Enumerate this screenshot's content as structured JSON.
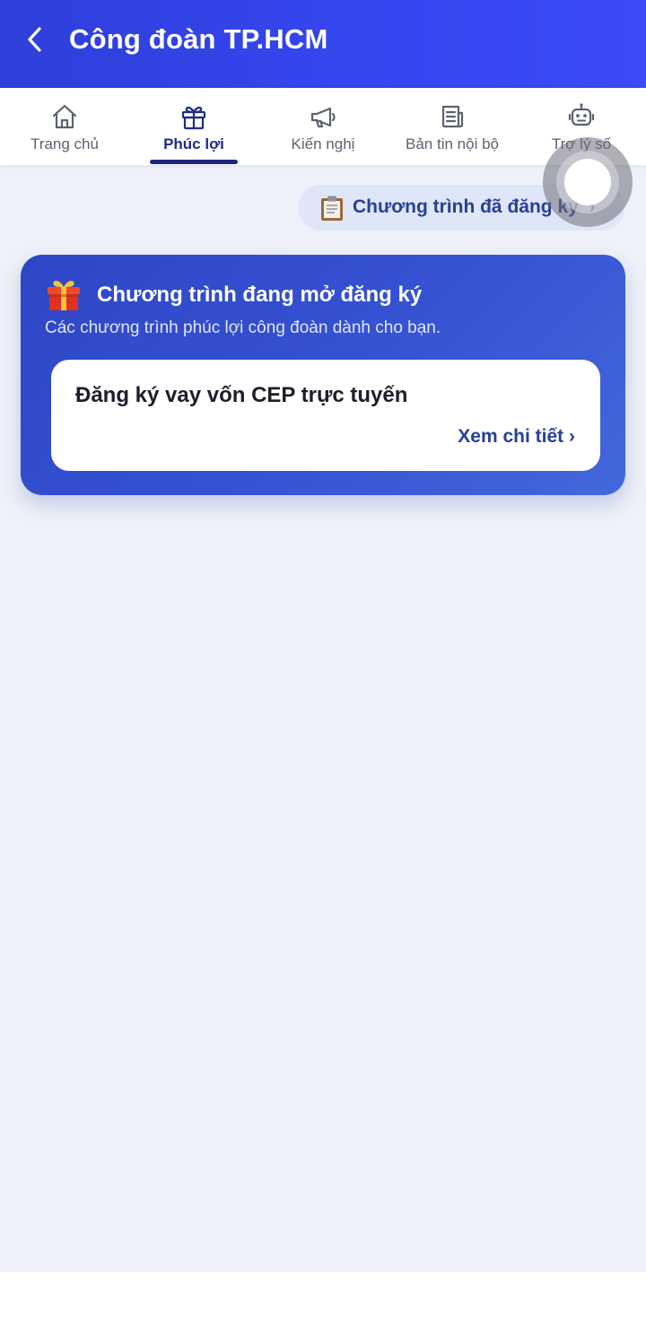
{
  "header": {
    "title": "Công đoàn TP.HCM",
    "background_color": "#3446f0"
  },
  "tabs": [
    {
      "label": "Trang chủ",
      "icon": "home-icon",
      "active": false
    },
    {
      "label": "Phúc lợi",
      "icon": "gift-icon",
      "active": true
    },
    {
      "label": "Kiến nghị",
      "icon": "megaphone-icon",
      "active": false
    },
    {
      "label": "Bản tin nội bộ",
      "icon": "newspaper-icon",
      "active": false
    },
    {
      "label": "Trợ lý số",
      "icon": "robot-icon",
      "active": false
    }
  ],
  "registered": {
    "label": "Chương trình đã đăng ký",
    "chevron": "›",
    "icon": "clipboard-icon"
  },
  "open_programs": {
    "title": "Chương trình đang mở đăng ký",
    "subtitle": "Các chương trình phúc lợi công đoàn dành cho bạn.",
    "icon": "gift-box-icon",
    "items": [
      {
        "title": "Đăng ký vay vốn CEP trực tuyến",
        "link_label": "Xem chi tiết ›"
      }
    ]
  },
  "colors": {
    "accent": "#26409a",
    "active_tab": "#1f2c8a",
    "card": "#3553d3",
    "background": "#eef1f8"
  }
}
